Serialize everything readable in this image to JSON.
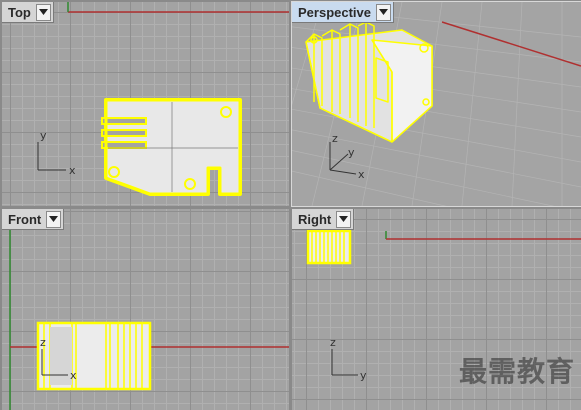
{
  "viewports": {
    "top": {
      "title": "Top"
    },
    "perspective": {
      "title": "Perspective"
    },
    "front": {
      "title": "Front"
    },
    "right": {
      "title": "Right"
    }
  },
  "axes": {
    "x": "x",
    "y": "y",
    "z": "z"
  },
  "active_viewport": "perspective",
  "colors": {
    "selection": "#ffff00",
    "x_axis": "#b03030",
    "y_axis": "#2f8a2f",
    "grid_major": "#8f8f8f",
    "grid_minor": "#b0b0b0",
    "active_tab": "#c9dbef"
  },
  "watermark": "最需教育",
  "icons": {
    "dropdown": "chevron-down-icon"
  }
}
